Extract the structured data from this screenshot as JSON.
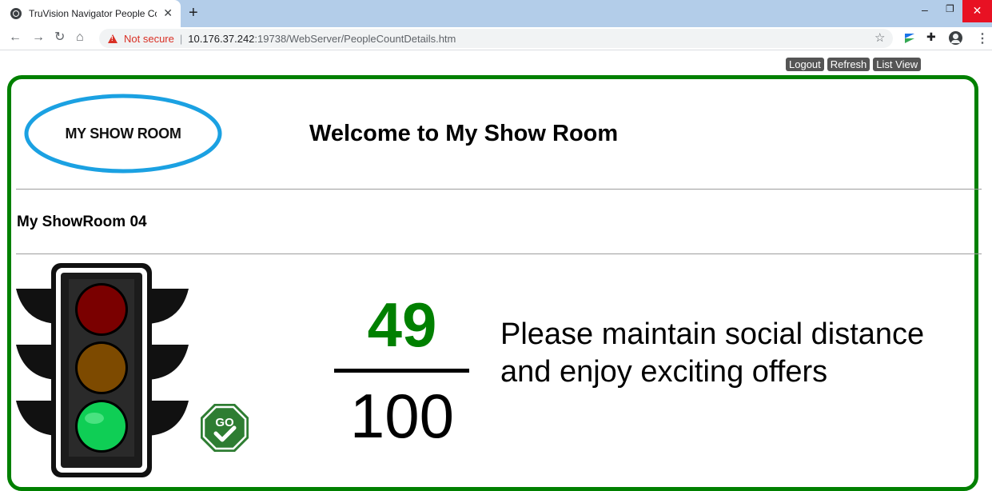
{
  "browser": {
    "tab_title": "TruVision Navigator People Coun",
    "new_tab": "+",
    "close": "✕",
    "security_label": "Not secure",
    "url_host": "10.176.37.242",
    "url_path": ":19738/WebServer/PeopleCountDetails.htm"
  },
  "page": {
    "buttons": {
      "logout": "Logout",
      "refresh": "Refresh",
      "list_view": "List View"
    },
    "logo_text": "MY SHOW ROOM",
    "welcome": "Welcome to My Show Room",
    "location": "My ShowRoom 04",
    "count": "49",
    "capacity": "100",
    "message": "Please maintain social distance and enjoy exciting offers",
    "go_sign_text": "GO",
    "status_light": "green",
    "colors": {
      "border": "#008000",
      "count": "#008000",
      "logo_ring": "#1ba1e2",
      "button_bg": "#555555"
    }
  }
}
